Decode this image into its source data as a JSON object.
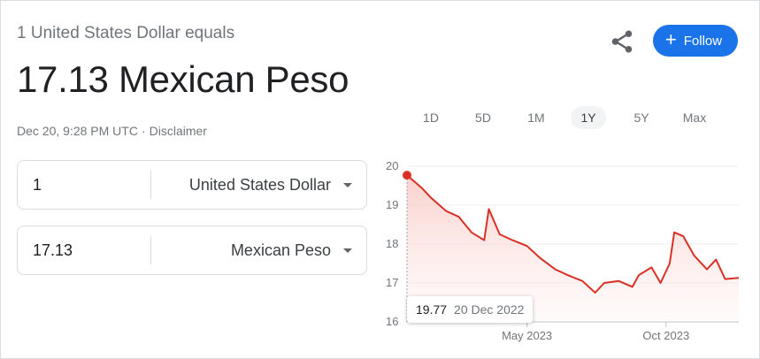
{
  "header": {
    "headline": "1 United States Dollar equals",
    "result": "17.13 Mexican Peso",
    "timestamp": "Dec 20, 9:28 PM UTC",
    "disclaimer": "Disclaimer",
    "follow_label": "Follow"
  },
  "ranges": [
    {
      "label": "1D",
      "active": false
    },
    {
      "label": "5D",
      "active": false
    },
    {
      "label": "1M",
      "active": false
    },
    {
      "label": "1Y",
      "active": true
    },
    {
      "label": "5Y",
      "active": false
    },
    {
      "label": "Max",
      "active": false
    }
  ],
  "converter": {
    "from": {
      "value": "1",
      "currency": "United States Dollar"
    },
    "to": {
      "value": "17.13",
      "currency": "Mexican Peso"
    }
  },
  "tooltip": {
    "value": "19.77",
    "date": "20 Dec 2022"
  },
  "colors": {
    "accent": "#1a73e8",
    "line": "#d93025",
    "fill": "#fce8e6"
  },
  "chart_data": {
    "type": "line",
    "ylim": [
      16,
      20
    ],
    "yticks": [
      "20",
      "19",
      "18",
      "17",
      "16"
    ],
    "xticks": [
      {
        "label": "May 2023",
        "x": "2023-05-01"
      },
      {
        "label": "Oct 2023",
        "x": "2023-10-01"
      }
    ],
    "x": [
      "2022-12-20",
      "2023-01-05",
      "2023-01-15",
      "2023-02-01",
      "2023-02-15",
      "2023-03-01",
      "2023-03-15",
      "2023-03-20",
      "2023-04-01",
      "2023-04-15",
      "2023-05-01",
      "2023-05-15",
      "2023-06-01",
      "2023-06-15",
      "2023-07-01",
      "2023-07-15",
      "2023-07-25",
      "2023-08-10",
      "2023-08-25",
      "2023-09-01",
      "2023-09-15",
      "2023-09-25",
      "2023-10-05",
      "2023-10-10",
      "2023-10-20",
      "2023-11-01",
      "2023-11-15",
      "2023-11-25",
      "2023-12-05",
      "2023-12-20"
    ],
    "values": [
      19.77,
      19.45,
      19.2,
      18.85,
      18.7,
      18.3,
      18.1,
      18.9,
      18.25,
      18.1,
      17.95,
      17.65,
      17.35,
      17.2,
      17.05,
      16.75,
      17.0,
      17.05,
      16.9,
      17.2,
      17.4,
      17.0,
      17.5,
      18.3,
      18.2,
      17.7,
      17.35,
      17.6,
      17.1,
      17.13
    ]
  }
}
